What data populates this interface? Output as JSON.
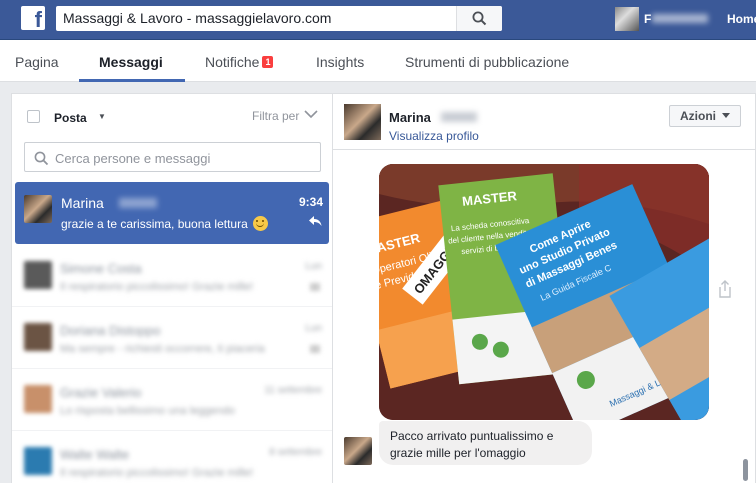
{
  "topbar": {
    "search_value": "Massaggi & Lavoro - massaggielavoro.com",
    "profile_initial": "F",
    "home_label": "Home",
    "brand_color": "#3b5998"
  },
  "tabs": [
    {
      "label": "Pagina"
    },
    {
      "label": "Messaggi",
      "active": true
    },
    {
      "label": "Notifiche",
      "badge": "1"
    },
    {
      "label": "Insights"
    },
    {
      "label": "Strumenti di pubblicazione"
    }
  ],
  "inbox": {
    "folder_label": "Posta",
    "filter_label": "Filtra per",
    "search_placeholder": "Cerca persone e messaggi",
    "active_thread": {
      "name": "Marina",
      "snippet": "grazie a te carissima, buona lettura",
      "time": "9:34"
    },
    "blurred_threads": [
      {
        "name": "Simone Costa",
        "snippet": "Il respiratorio piccolissimo! Grazie mille!",
        "time": "Lun"
      },
      {
        "name": "Doriana Distoppo",
        "snippet": "Ma sempre - richiesti occorrere, ti piaceria",
        "time": "Lun"
      },
      {
        "name": "Grazie Valerio",
        "snippet": "Lo risposta bellissimo una leggendo",
        "time": "11 settembre"
      },
      {
        "name": "Walte Walte",
        "snippet": "Il respiratorio piccolissimo! Grazie mille!",
        "time": "8 settembre"
      }
    ]
  },
  "conversation": {
    "name": "Marina",
    "profile_link": "Visualizza profilo",
    "actions_label": "Azioni",
    "photo_texts": {
      "master_title": "MASTER",
      "master_desc_1": "La scheda conoscitiva",
      "master_desc_2": "del cliente nella vendita dei",
      "master_desc_3": "servizi di benessere",
      "blue_title_1": "Come Aprire",
      "blue_title_2": "uno Studio Privato",
      "blue_title_3": "di Massaggi Benes",
      "blue_sub": "La Guida Fiscale C",
      "orange_1": "MASTER",
      "orange_2": "Operatori Olistici",
      "orange_3": "e Previdenza Sociale",
      "omaggio": "OMAGGIO",
      "brand": "Massaggi & Lavoro"
    },
    "message": "Pacco arrivato puntualissimo e grazie mille per l'omaggio"
  }
}
